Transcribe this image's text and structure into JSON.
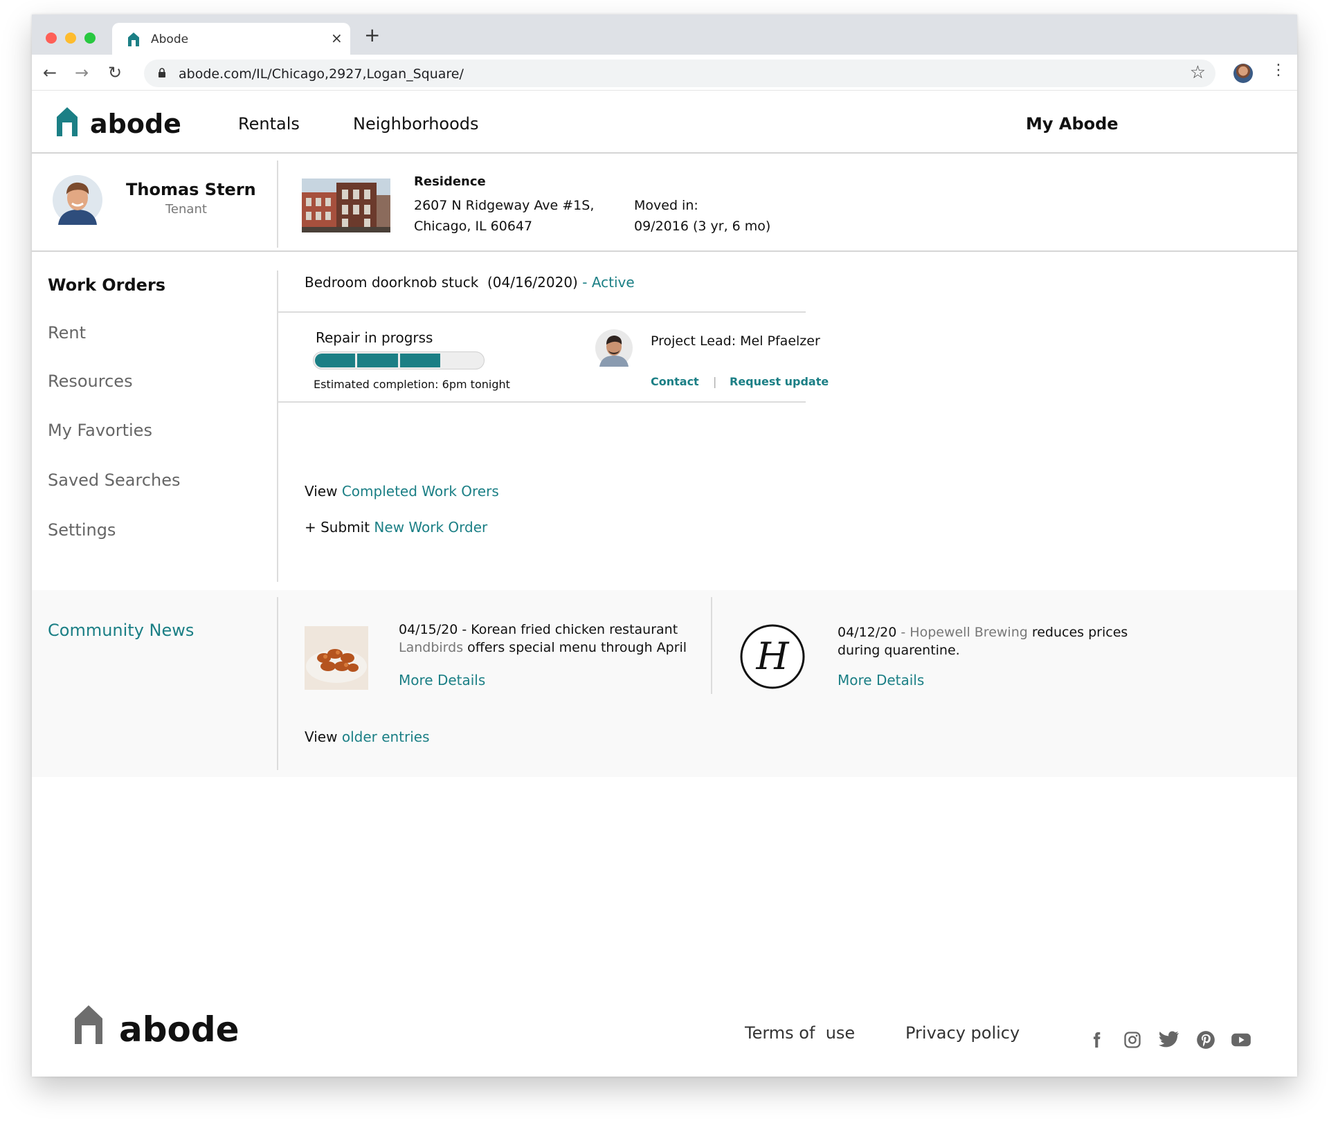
{
  "browser": {
    "tab_title": "Abode",
    "tab_close": "×",
    "new_tab": "+",
    "url": "abode.com/IL/Chicago,2927,Logan_Square/",
    "back": "←",
    "forward": "→",
    "reload": "↻",
    "bookmark": "☆",
    "menu": "⋮"
  },
  "header": {
    "logo": "abode",
    "nav": [
      "Rentals",
      "Neighborhoods"
    ],
    "account": "My Abode"
  },
  "profile": {
    "name": "Thomas Stern",
    "role": "Tenant"
  },
  "residence": {
    "label": "Residence",
    "address_line1": "2607 N Ridgeway Ave #1S,",
    "address_line2": "Chicago, IL 60647",
    "moved_label": "Moved in:",
    "moved_value": "09/2016 (3 yr, 6 mo)"
  },
  "sidebar": {
    "items": [
      "Work Orders",
      "Rent",
      "Resources",
      "My Favorties",
      "Saved Searches",
      "Settings"
    ],
    "active": "Work Orders"
  },
  "work_order": {
    "title": "Bedroom doorknob stuck  (04/16/2020)",
    "separator": " - ",
    "status": "Active",
    "progress_label": "Repair in progrss",
    "progress_segments_filled": 3,
    "progress_segments_total": 4,
    "estimate": "Estimated completion: 6pm tonight",
    "lead": "Project Lead: Mel Pfaelzer",
    "contact": "Contact",
    "divider": "|",
    "request": "Request update"
  },
  "work_links": {
    "view_prefix": "View ",
    "view_link": "Completed Work Orers",
    "submit_prefix": "+ Submit ",
    "submit_link": "New Work Order"
  },
  "community": {
    "heading": "Community News",
    "news": [
      {
        "date": "04/15/20",
        "line1_rest": " - Korean fried chicken restaurant",
        "venue": "Landbirds",
        "line2_rest": " offers special menu through April",
        "more": "More Details"
      },
      {
        "date": "04/12/20",
        "sep": " - ",
        "venue": "Hopewell Brewing",
        "line1_rest": " reduces prices",
        "line2": "during quarentine.",
        "more": "More Details",
        "logo_letter": "H"
      }
    ],
    "older_prefix": "View ",
    "older_link": "older entries"
  },
  "footer": {
    "logo": "abode",
    "links": [
      "Terms of  use",
      "Privacy policy"
    ],
    "social": [
      "facebook-icon",
      "instagram-icon",
      "twitter-icon",
      "pinterest-icon",
      "youtube-icon"
    ]
  },
  "colors": {
    "accent": "#1b7f85",
    "progress": "#1b7f85",
    "community_bg": "#f9f9f9"
  }
}
